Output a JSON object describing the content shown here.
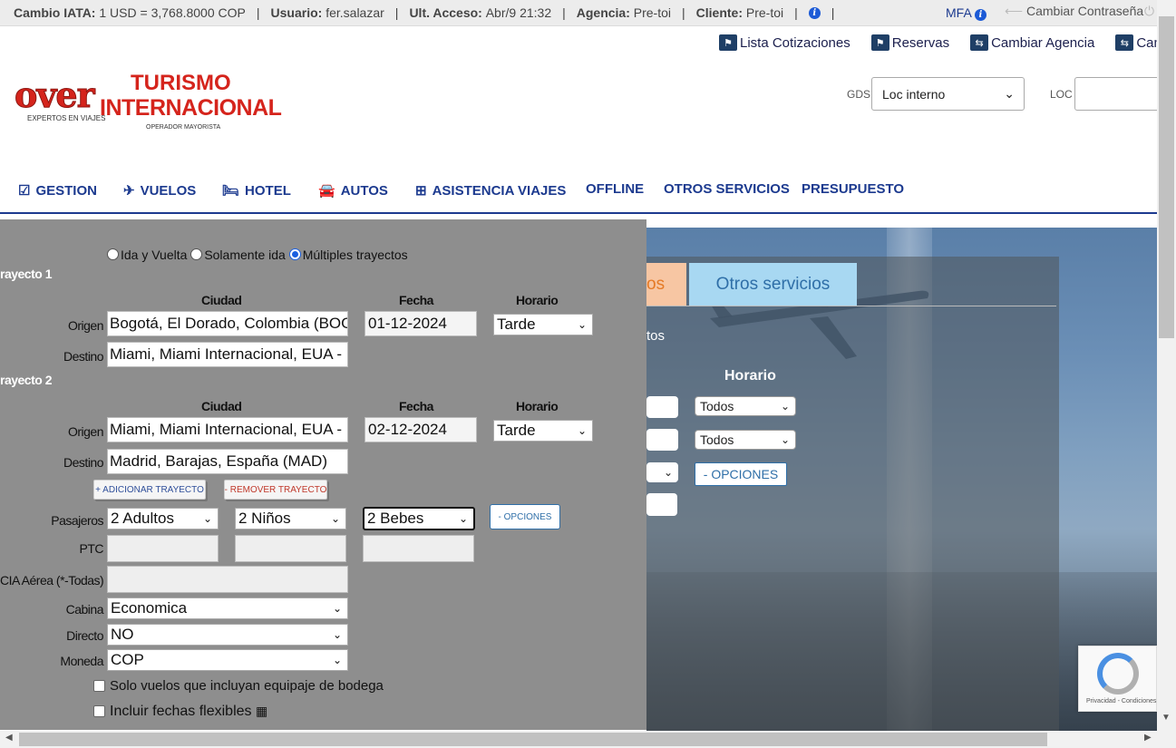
{
  "topbar": {
    "cambio_label": "Cambio IATA:",
    "cambio_value": "1 USD = 3,768.8000 COP",
    "usuario_label": "Usuario:",
    "usuario_value": "fer.salazar",
    "acceso_label": "Ult. Acceso:",
    "acceso_value": "Abr/9 21:32",
    "agencia_label": "Agencia:",
    "agencia_value": "Pre-toi",
    "cliente_label": "Cliente:",
    "cliente_value": "Pre-toi",
    "separator": "|",
    "mfa": "MFA",
    "change_password": "Cambiar Contraseña"
  },
  "actions": [
    {
      "label": "Lista Cotizaciones",
      "icon": "flag-icon"
    },
    {
      "label": "Reservas",
      "icon": "flag-icon"
    },
    {
      "label": "Cambiar Agencia",
      "icon": "swap-icon"
    },
    {
      "label": "Cam",
      "icon": "swap-icon"
    }
  ],
  "logo": {
    "over": "over",
    "expertos": "EXPERTOS EN VIAJES",
    "turismo": "TURISMO",
    "internacional": "INTERNACIONAL",
    "operador": "OPERADOR MAYORISTA"
  },
  "gds": {
    "label": "GDS",
    "value": "Loc interno"
  },
  "loc": {
    "label": "LOC",
    "value": ""
  },
  "nav": [
    {
      "label": "GESTION",
      "icon": "check-square-icon"
    },
    {
      "label": "VUELOS",
      "icon": "plane-icon"
    },
    {
      "label": "HOTEL",
      "icon": "bed-icon"
    },
    {
      "label": "AUTOS",
      "icon": "car-icon"
    },
    {
      "label": "ASISTENCIA VIAJES",
      "icon": "medkit-icon"
    },
    {
      "label": "OFFLINE",
      "icon": ""
    },
    {
      "label": "OTROS SERVICIOS",
      "icon": ""
    },
    {
      "label": "PRESUPUESTO",
      "icon": ""
    }
  ],
  "background": {
    "tab_partial": "os",
    "tab_other": "Otros servicios",
    "tos_partial": "tos",
    "horario": "Horario",
    "select_todos": "Todos",
    "opciones": "- OPCIONES"
  },
  "form": {
    "trip_types": [
      {
        "label": "Ida y Vuelta",
        "selected": false
      },
      {
        "label": "Solamente ida",
        "selected": false
      },
      {
        "label": "Múltiples trayectos",
        "selected": true
      }
    ],
    "col_ciudad": "Ciudad",
    "col_fecha": "Fecha",
    "col_horario": "Horario",
    "origen_label": "Origen",
    "destino_label": "Destino",
    "segments": [
      {
        "title": "rayecto 1",
        "origen": "Bogotá, El Dorado, Colombia (BOG",
        "destino": "Miami, Miami Internacional, EUA -",
        "fecha": "01-12-2024",
        "horario": "Tarde"
      },
      {
        "title": "rayecto 2",
        "origen": "Miami, Miami Internacional, EUA -",
        "destino": "Madrid, Barajas, España (MAD)",
        "fecha": "02-12-2024",
        "horario": "Tarde"
      }
    ],
    "add_segment": "+ ADICIONAR TRAYECTO",
    "remove_segment": "- REMOVER TRAYECTO",
    "pasajeros_label": "Pasajeros",
    "adultos": "2 Adultos",
    "ninos": "2 Niños",
    "bebes": "2 Bebes",
    "opciones": "- OPCIONES",
    "ptc_label": "PTC",
    "cia_label": "CIA Aérea (*-Todas)",
    "cabina_label": "Cabina",
    "cabina_value": "Economica",
    "directo_label": "Directo",
    "directo_value": "NO",
    "moneda_label": "Moneda",
    "moneda_value": "COP",
    "equipaje_label": "Solo vuelos que incluyan equipaje de bodega",
    "flexibles_label": "Incluir fechas flexibles"
  },
  "recaptcha": {
    "text": "Privacidad - Condiciones"
  }
}
